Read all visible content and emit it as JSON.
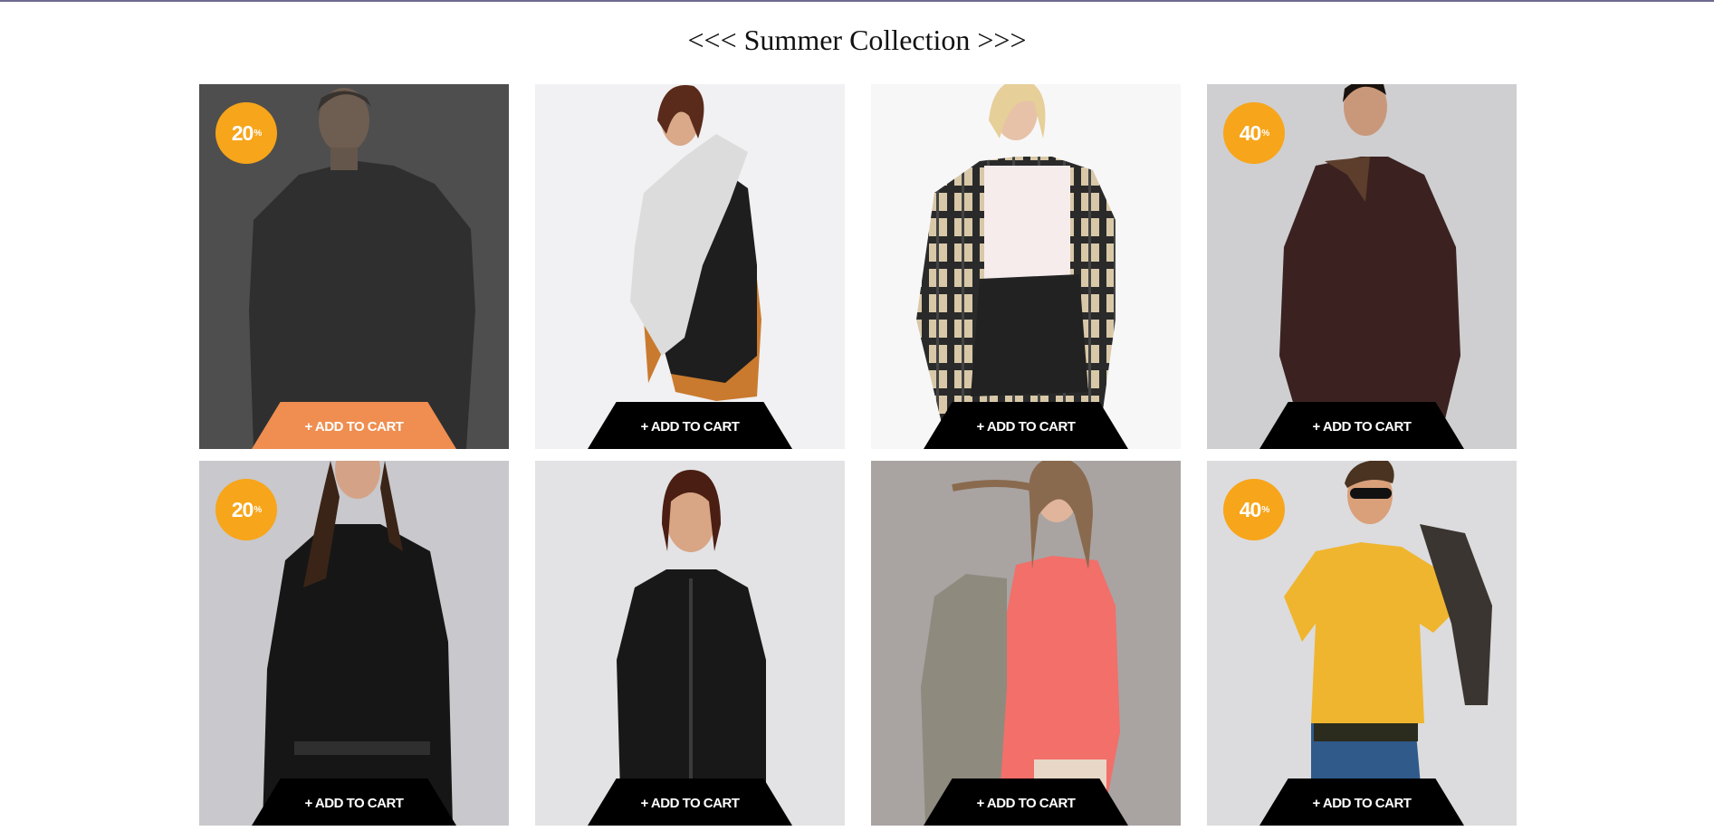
{
  "page": {
    "title": "<<< Summer Collection >>>"
  },
  "colors": {
    "badge": "#f7a51a",
    "cart_button": "#000000",
    "cart_button_hover": "#ef8e50",
    "top_line": "#6e6a8e"
  },
  "products": [
    {
      "badge": "20",
      "badge_suffix": "%",
      "cart_label": "+ ADD TO CART",
      "hover": true
    },
    {
      "badge": "",
      "badge_suffix": "",
      "cart_label": "+ ADD TO CART",
      "hover": false
    },
    {
      "badge": "",
      "badge_suffix": "",
      "cart_label": "+ ADD TO CART",
      "hover": false
    },
    {
      "badge": "40",
      "badge_suffix": "%",
      "cart_label": "+ ADD TO CART",
      "hover": false
    },
    {
      "badge": "20",
      "badge_suffix": "%",
      "cart_label": "+ ADD TO CART",
      "hover": false
    },
    {
      "badge": "",
      "badge_suffix": "",
      "cart_label": "+ ADD TO CART",
      "hover": false
    },
    {
      "badge": "",
      "badge_suffix": "",
      "cart_label": "+ ADD TO CART",
      "hover": false
    },
    {
      "badge": "40",
      "badge_suffix": "%",
      "cart_label": "+ ADD TO CART",
      "hover": false
    }
  ]
}
